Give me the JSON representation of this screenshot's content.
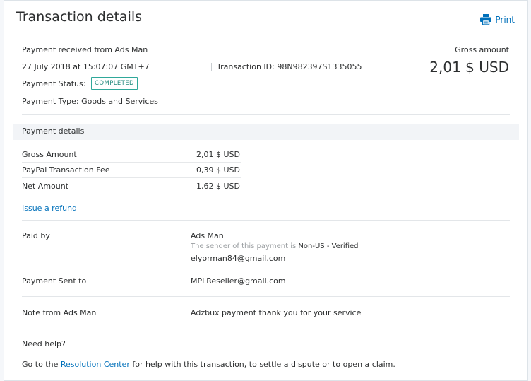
{
  "header": {
    "title": "Transaction details",
    "print_label": "Print"
  },
  "summary": {
    "received_from": "Payment received from Ads Man",
    "date": "27 July 2018 at 15:07:07 GMT+7",
    "transaction_id": "Transaction ID: 98N982397S1335055",
    "status_label": "Payment Status:",
    "status_badge": "COMPLETED",
    "payment_type": "Payment Type: Goods and Services",
    "gross_label": "Gross amount",
    "gross_value": "2,01 $ USD"
  },
  "details": {
    "section_title": "Payment details",
    "rows": [
      {
        "label": "Gross Amount",
        "value": "2,01 $ USD"
      },
      {
        "label": "PayPal Transaction Fee",
        "value": "−0,39 $ USD"
      },
      {
        "label": "Net Amount",
        "value": "1,62 $ USD"
      }
    ],
    "refund_link": "Issue a refund"
  },
  "paid_by": {
    "label": "Paid by",
    "name": "Ads Man",
    "sender_note": "The sender of this payment is",
    "sender_status": "Non-US - Verified",
    "email": "elyorman84@gmail.com"
  },
  "sent_to": {
    "label": "Payment Sent to",
    "email": "MPLReseller@gmail.com"
  },
  "note": {
    "label": "Note from Ads Man",
    "text": "Adzbux payment thank you for your service"
  },
  "help": {
    "title": "Need help?",
    "prefix": "Go to the",
    "link": "Resolution Center",
    "suffix": "for help with this transaction, to settle a dispute or to open a claim."
  },
  "colors": {
    "link": "#0070ba",
    "badge": "#2fa89a",
    "band": "#f2f4f7"
  }
}
